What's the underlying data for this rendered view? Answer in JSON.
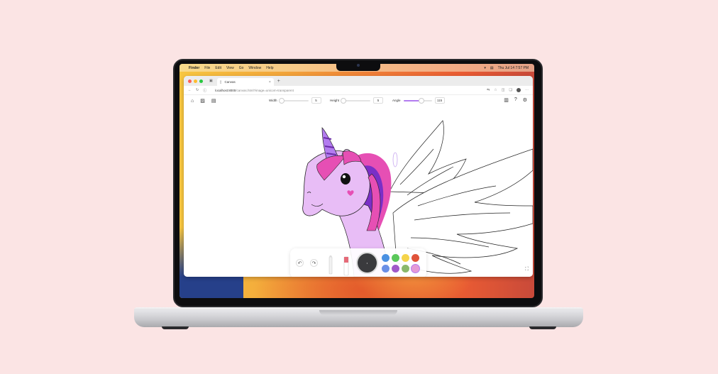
{
  "menubar": {
    "app": "Finder",
    "items": [
      "File",
      "Edit",
      "View",
      "Go",
      "Window",
      "Help"
    ],
    "clock": "Thu Jul 14  7:57 PM"
  },
  "browser": {
    "tab_title": "Canvas",
    "url_host": "localhost:8000",
    "url_path": "/canvas.html?image=unicorn-transparent"
  },
  "toolbar": {
    "width_label": "Width",
    "width_value": "5",
    "width_fraction": 0.05,
    "height_label": "Height",
    "height_value": "5",
    "height_fraction": 0.05,
    "angle_label": "Angle",
    "angle_value": "115",
    "angle_fraction": 0.64
  },
  "palette": {
    "swatches": [
      "#4a90e2",
      "#5ac85a",
      "#f5d44a",
      "#e0533a",
      "#6a8fe6",
      "#a05ac8",
      "#8bb96a",
      "#e59ad6"
    ],
    "brush_dot": "•"
  },
  "colors": {
    "accent": "#b37cf0",
    "unicorn_mane_pink": "#e64fb4",
    "unicorn_mane_purple": "#7a2fc7",
    "unicorn_body": "#e8bdf6"
  }
}
